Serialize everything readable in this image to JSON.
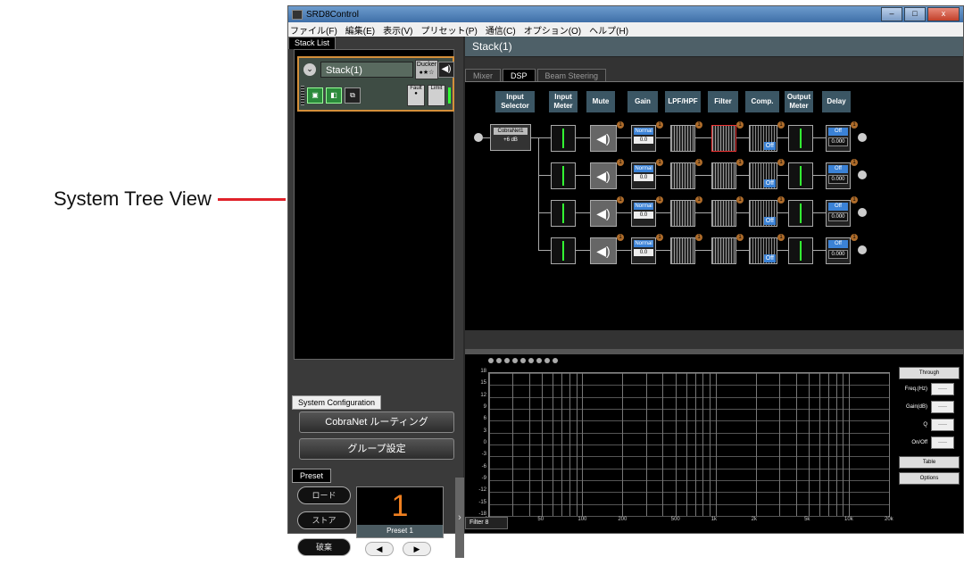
{
  "annotation": {
    "label": "System Tree View"
  },
  "window": {
    "title": "SRD8Control",
    "min": "‒",
    "max": "□",
    "close": "x"
  },
  "menu": [
    "ファイル(F)",
    "編集(E)",
    "表示(V)",
    "プリセット(P)",
    "通信(C)",
    "オプション(O)",
    "ヘルプ(H)"
  ],
  "stack_list": {
    "tab": "Stack List",
    "card": {
      "name": "Stack(1)",
      "ducker": "Ducker",
      "fault": "Fault",
      "limit": "Limit"
    }
  },
  "system_configuration": {
    "tab": "System Configuration",
    "buttons": [
      "CobraNet ルーティング",
      "グループ設定"
    ]
  },
  "preset": {
    "tab": "Preset",
    "buttons": [
      "ロード",
      "ストア",
      "破棄"
    ],
    "number": "1",
    "name": "Preset 1"
  },
  "main": {
    "title": "Stack(1)",
    "tabs": [
      "Mixer",
      "DSP",
      "Beam Steering"
    ],
    "active_tab": "DSP",
    "headers": [
      "Input Selector",
      "Input Meter",
      "Mute",
      "Gain",
      "LPF/HPF",
      "Filter",
      "Comp.",
      "Output Meter",
      "Delay"
    ],
    "input_selector": {
      "button": "CobraNet1",
      "value": "+6 dB"
    },
    "gain_mode": "Normal",
    "gain_value": "0.0",
    "delay_state": "Off",
    "delay_value": "0.000",
    "comp_state": "Off",
    "badge": "1"
  },
  "filter": {
    "name": "Filter 8",
    "y_ticks": [
      "18",
      "15",
      "12",
      "9",
      "6",
      "3",
      "0",
      "-3",
      "-6",
      "-9",
      "-12",
      "-15",
      "-18"
    ],
    "x_ticks": [
      "20",
      "50",
      "100",
      "200",
      "500",
      "1k",
      "2k",
      "5k",
      "10k",
      "20k"
    ],
    "controls": {
      "type": "Through",
      "freq_label": "Freq.(Hz)",
      "gain_label": "Gain(dB)",
      "q_label": "Q",
      "onoff_label": "On/Off",
      "empty": "-----",
      "table": "Table",
      "options": "Options"
    }
  }
}
